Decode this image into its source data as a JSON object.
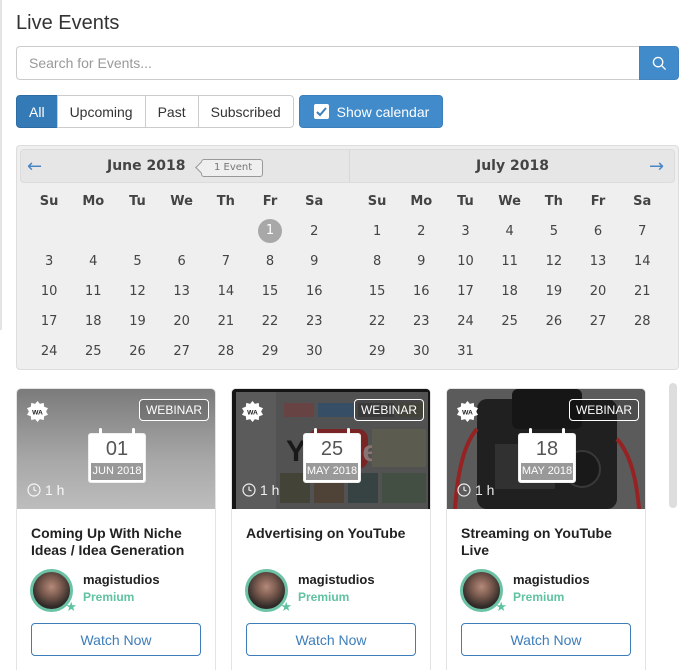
{
  "page": {
    "title": "Live Events"
  },
  "search": {
    "placeholder": "Search for Events...",
    "value": "",
    "button_icon": "search-icon"
  },
  "filters": {
    "tabs": [
      {
        "label": "All",
        "active": true
      },
      {
        "label": "Upcoming",
        "active": false
      },
      {
        "label": "Past",
        "active": false
      },
      {
        "label": "Subscribed",
        "active": false
      }
    ],
    "calendar_toggle": {
      "label": "Show calendar",
      "checked": true
    }
  },
  "calendar": {
    "prev_icon": "arrow-left-icon",
    "next_icon": "arrow-right-icon",
    "weekdays": [
      "Su",
      "Mo",
      "Tu",
      "We",
      "Th",
      "Fr",
      "Sa"
    ],
    "months": [
      {
        "title": "June 2018",
        "event_badge": "1 Event",
        "weeks": [
          [
            "",
            "",
            "",
            "",
            "",
            "1",
            "2"
          ],
          [
            "3",
            "4",
            "5",
            "6",
            "7",
            "8",
            "9"
          ],
          [
            "10",
            "11",
            "12",
            "13",
            "14",
            "15",
            "16"
          ],
          [
            "17",
            "18",
            "19",
            "20",
            "21",
            "22",
            "23"
          ],
          [
            "24",
            "25",
            "26",
            "27",
            "28",
            "29",
            "30"
          ]
        ],
        "highlighted_days": [
          "1"
        ]
      },
      {
        "title": "July 2018",
        "event_badge": "",
        "weeks": [
          [
            "1",
            "2",
            "3",
            "4",
            "5",
            "6",
            "7"
          ],
          [
            "8",
            "9",
            "10",
            "11",
            "12",
            "13",
            "14"
          ],
          [
            "15",
            "16",
            "17",
            "18",
            "19",
            "20",
            "21"
          ],
          [
            "22",
            "23",
            "24",
            "25",
            "26",
            "27",
            "28"
          ],
          [
            "29",
            "30",
            "31",
            "",
            "",
            "",
            ""
          ]
        ],
        "highlighted_days": []
      }
    ]
  },
  "events": [
    {
      "type": "WEBINAR",
      "day": "01",
      "month_year": "JUN 2018",
      "duration": "1 h",
      "title": "Coming Up With Niche Ideas / Idea Generation",
      "author": "magistudios",
      "tier": "Premium",
      "cta": "Watch Now"
    },
    {
      "type": "WEBINAR",
      "day": "25",
      "month_year": "MAY 2018",
      "duration": "1 h",
      "title": "Advertising on YouTube",
      "author": "magistudios",
      "tier": "Premium",
      "cta": "Watch Now"
    },
    {
      "type": "WEBINAR",
      "day": "18",
      "month_year": "MAY 2018",
      "duration": "1 h",
      "title": "Streaming on YouTube Live",
      "author": "magistudios",
      "tier": "Premium",
      "cta": "Watch Now"
    }
  ],
  "colors": {
    "primary": "#428bca",
    "active_tab": "#337ab7",
    "premium": "#5fc2a0",
    "highlight_day": "#a8a8a8"
  }
}
